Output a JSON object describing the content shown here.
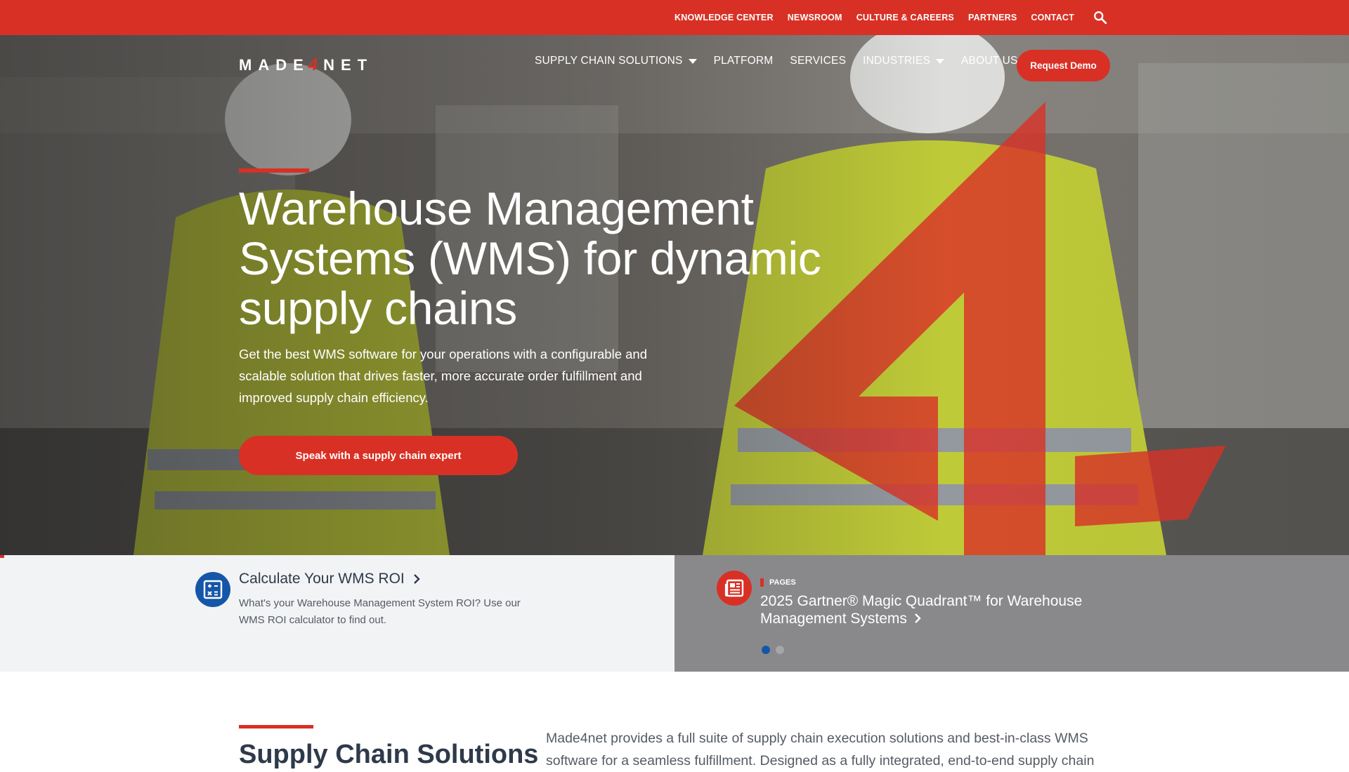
{
  "topbar": {
    "links": [
      "KNOWLEDGE CENTER",
      "NEWSROOM",
      "CULTURE & CAREERS",
      "PARTNERS",
      "CONTACT"
    ],
    "search_icon": "search-icon"
  },
  "header": {
    "logo_left": "MADE",
    "logo_four": "4",
    "logo_right": "NET",
    "nav": [
      {
        "label": "SUPPLY CHAIN SOLUTIONS"
      },
      {
        "label": "PLATFORM"
      },
      {
        "label": "SERVICES"
      },
      {
        "label": "INDUSTRIES"
      },
      {
        "label": "ABOUT US"
      }
    ],
    "demo_label": "Request Demo"
  },
  "hero": {
    "title": "Warehouse Management Systems (WMS) for dynamic supply chains",
    "subtitle": "Get the best WMS software for your operations with a configurable and scalable solution that drives faster, more accurate order fulfillment and improved supply chain efficiency.",
    "cta_label": "Speak with a supply chain expert"
  },
  "cards": {
    "roi": {
      "title": "Calculate Your WMS ROI",
      "text": "What's your Warehouse Management System ROI? Use our WMS ROI calculator to find out.",
      "icon": "calculator-icon"
    },
    "news": {
      "tag": "PAGES",
      "title": "2025 Gartner® Magic Quadrant™ for Warehouse Management Systems",
      "icon": "newspaper-icon"
    }
  },
  "section": {
    "title": "Supply Chain Solutions",
    "text": "Made4net provides a full suite of supply chain execution solutions and best-in-class WMS software for a seamless fulfillment. Designed as a fully integrated, end-to-end supply chain"
  },
  "colors": {
    "brand_red": "#d93025",
    "brand_blue": "#1556a8",
    "dark_text": "#2e3a4a"
  }
}
